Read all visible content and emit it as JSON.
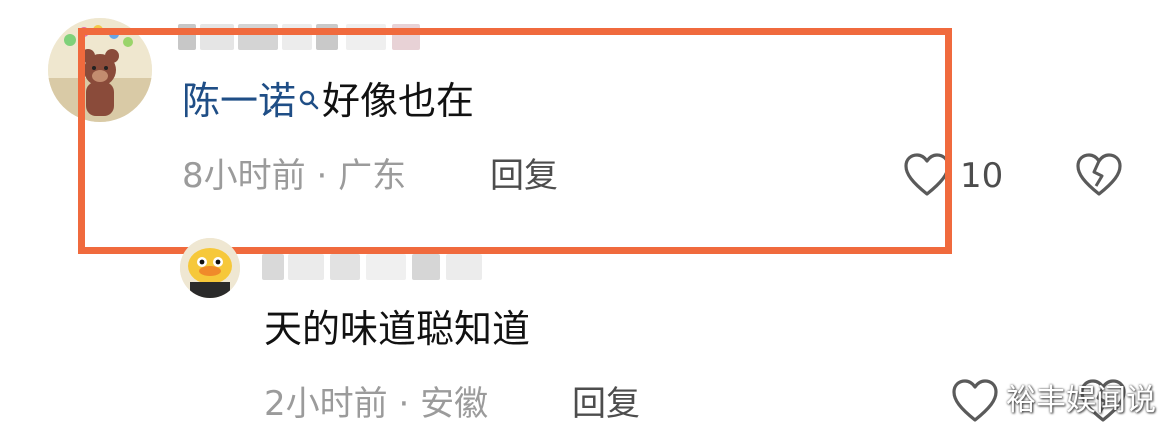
{
  "comment1": {
    "mention": "陈一诺",
    "text": "好像也在",
    "time": "8小时前",
    "separator": "·",
    "location": "广东",
    "reply_label": "回复",
    "like_count": "10"
  },
  "comment2": {
    "text": "天的味道聪知道",
    "time": "2小时前",
    "separator": "·",
    "location": "安徽",
    "reply_label": "回复"
  },
  "watermark": "裕丰娱闻说",
  "colors": {
    "highlight": "#f06a3d",
    "mention": "#1f4e86",
    "meta_text": "#9b9b9b",
    "icon": "#5a5a5a"
  },
  "icons": [
    "search-icon",
    "heart-icon",
    "broken-heart-icon"
  ]
}
